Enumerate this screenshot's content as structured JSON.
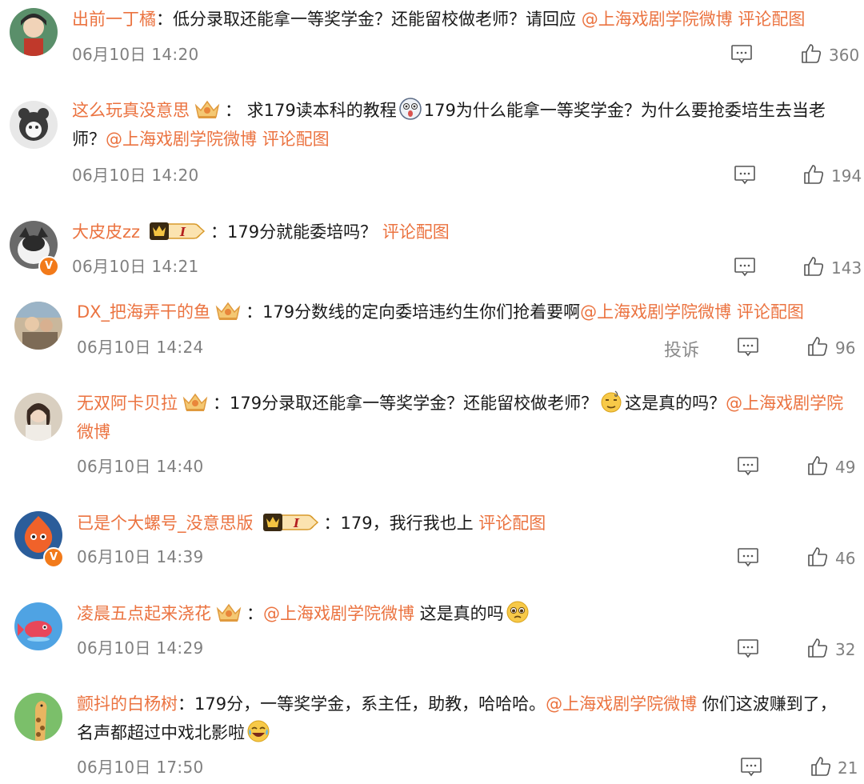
{
  "comments": [
    {
      "username": "出前一丁橘",
      "colon": "：",
      "text": "低分录取还能拿一等奖学金？还能留校做老师？请回应 ",
      "mention": "@上海戏剧学院微博",
      "text2": " ",
      "link": "评论配图",
      "time": "06月10日 14:20",
      "likes": "360"
    },
    {
      "username": "这么玩真没意思",
      "colon": "：",
      "text": " 求179读本科的教程",
      "text2": "179为什么能拿一等奖学金？为什么要抢委培生去当老师？",
      "mention": "@上海戏剧学院微博",
      "text3": " ",
      "link": "评论配图",
      "time": "06月10日 14:20",
      "likes": "194"
    },
    {
      "username": "大皮皮zz",
      "colon": "：",
      "text": "179分就能委培吗？ ",
      "link": "评论配图",
      "vip_level": "I",
      "time": "06月10日 14:21",
      "likes": "143"
    },
    {
      "username": "DX_把海弄干的鱼",
      "colon": "：",
      "text": "179分数线的定向委培违约生你们抢着要啊",
      "mention": "@上海戏剧学院微博",
      "text2": " ",
      "link": "评论配图",
      "time": "06月10日 14:24",
      "report": "投诉",
      "likes": "96"
    },
    {
      "username": "无双阿卡贝拉",
      "colon": "：",
      "text": "179分录取还能拿一等奖学金？还能留校做老师？",
      "text2": "这是真的吗？",
      "mention": "@上海戏剧学院微博",
      "time": "06月10日 14:40",
      "likes": "49"
    },
    {
      "username": "已是个大螺号_没意思版",
      "colon": "：",
      "text": "179，我行我也上 ",
      "link": "评论配图",
      "vip_level": "I",
      "time": "06月10日 14:39",
      "likes": "46"
    },
    {
      "username": "凌晨五点起来浇花",
      "colon": "：",
      "mention": "@上海戏剧学院微博",
      "text": " 这是真的吗",
      "time": "06月10日 14:29",
      "likes": "32"
    },
    {
      "username": "颤抖的白杨树",
      "colon": "：",
      "text": "179分，一等奖学金，系主任，助教，哈哈哈。",
      "mention": "@上海戏剧学院微博",
      "text2": " 你们这波赚到了，名声都超过中戏北影啦",
      "time": "06月10日 17:50",
      "likes": "21"
    }
  ],
  "colors": {
    "accent": "#eb7340",
    "text": "#1a1a1a",
    "meta": "#808080"
  },
  "icons": {
    "comment": "comment-icon",
    "like": "thumbs-up-icon",
    "medal": "crown-medal-icon",
    "vip": "vip-crown-badge-icon"
  }
}
